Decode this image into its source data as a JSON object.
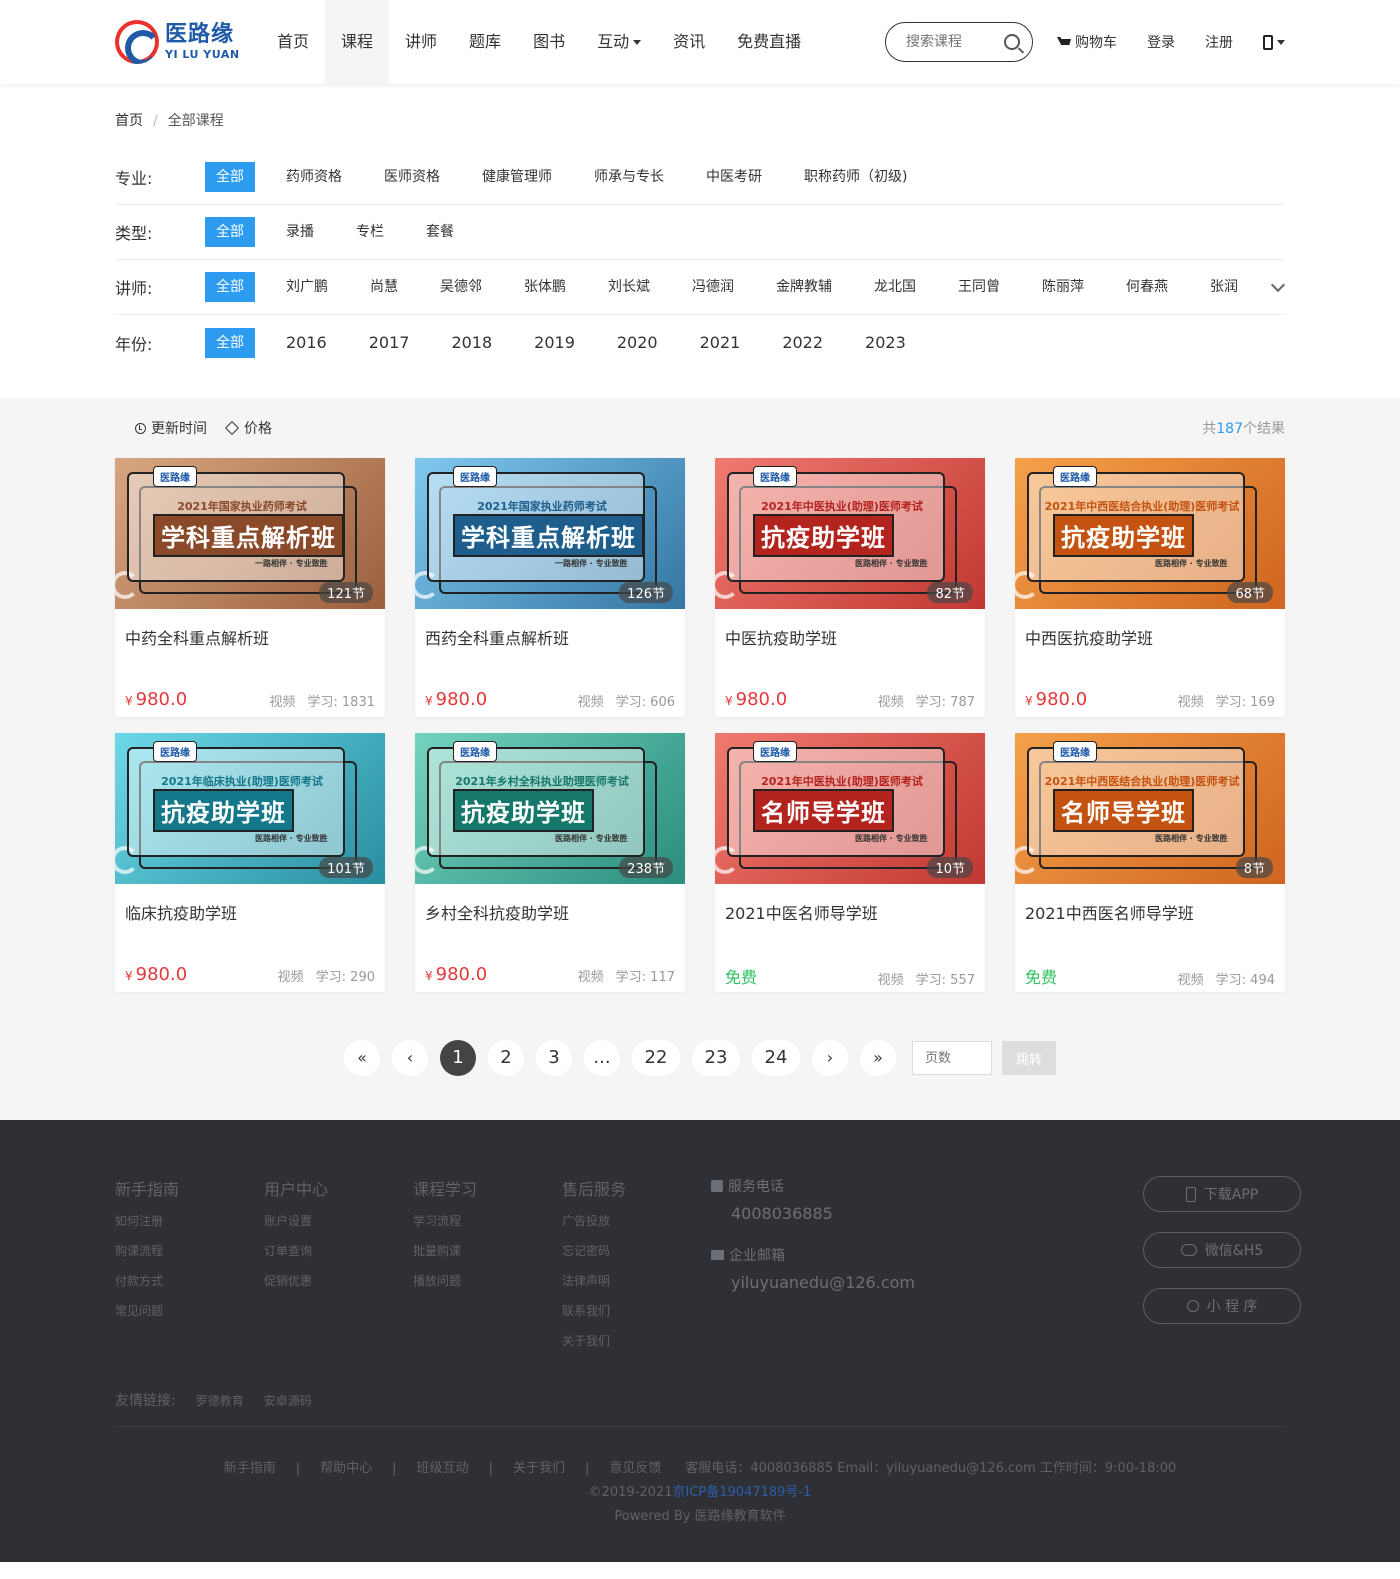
{
  "logo": {
    "cn": "医路缘",
    "en": "YI LU YUAN"
  },
  "nav": [
    {
      "label": "首页"
    },
    {
      "label": "课程",
      "active": true
    },
    {
      "label": "讲师"
    },
    {
      "label": "题库"
    },
    {
      "label": "图书"
    },
    {
      "label": "互动",
      "dropdown": true
    },
    {
      "label": "资讯"
    },
    {
      "label": "免费直播"
    }
  ],
  "search": {
    "placeholder": "搜索课程"
  },
  "header_links": {
    "cart": "购物车",
    "login": "登录",
    "register": "注册"
  },
  "breadcrumb": {
    "home": "首页",
    "current": "全部课程"
  },
  "filters": {
    "specialty": {
      "label": "专业:",
      "options": [
        "全部",
        "药师资格",
        "医师资格",
        "健康管理师",
        "师承与专长",
        "中医考研",
        "职称药师（初级)"
      ]
    },
    "type": {
      "label": "类型:",
      "options": [
        "全部",
        "录播",
        "专栏",
        "套餐"
      ]
    },
    "teacher": {
      "label": "讲师:",
      "options": [
        "全部",
        "刘广鹏",
        "尚慧",
        "吴德邻",
        "张体鹏",
        "刘长斌",
        "冯德润",
        "金牌教辅",
        "龙北国",
        "王同曾",
        "陈丽萍",
        "何春燕",
        "张润"
      ]
    },
    "year": {
      "label": "年份:",
      "options": [
        "全部",
        "2016",
        "2017",
        "2018",
        "2019",
        "2020",
        "2021",
        "2022",
        "2023"
      ]
    }
  },
  "sort": {
    "update_time": "更新时间",
    "price": "价格",
    "total_prefix": "共",
    "total": "187",
    "total_suffix": "个结果"
  },
  "courses": [
    {
      "title": "中药全科重点解析班",
      "price": "980.0",
      "currency": "¥",
      "type": "视频",
      "study": "学习: 1831",
      "lessons": "121节",
      "thumb_exam": "2021年国家执业药师考试",
      "thumb_title": "学科重点解析班",
      "thumb_sub": "一路相伴 · 专业致胜",
      "theme": "#d7a680",
      "accent": "#8a4a2a"
    },
    {
      "title": "西药全科重点解析班",
      "price": "980.0",
      "currency": "¥",
      "type": "视频",
      "study": "学习: 606",
      "lessons": "126节",
      "thumb_exam": "2021年国家执业药师考试",
      "thumb_title": "学科重点解析班",
      "thumb_sub": "一路相伴 · 专业致胜",
      "theme": "#7fc8ee",
      "accent": "#1d5e8c"
    },
    {
      "title": "中医抗疫助学班",
      "price": "980.0",
      "currency": "¥",
      "type": "视频",
      "study": "学习: 787",
      "lessons": "82节",
      "thumb_exam": "2021年中医执业(助理)医师考试",
      "thumb_title": "抗疫助学班",
      "thumb_sub": "医路相伴 · 专业致胜",
      "theme": "#f07a70",
      "accent": "#b3241f"
    },
    {
      "title": "中西医抗疫助学班",
      "price": "980.0",
      "currency": "¥",
      "type": "视频",
      "study": "学习: 169",
      "lessons": "68节",
      "thumb_exam": "2021年中西医结合执业(助理)医师考试",
      "thumb_title": "抗疫助学班",
      "thumb_sub": "医路相伴 · 专业致胜",
      "theme": "#f5a04a",
      "accent": "#c45312"
    },
    {
      "title": "临床抗疫助学班",
      "price": "980.0",
      "currency": "¥",
      "type": "视频",
      "study": "学习: 290",
      "lessons": "101节",
      "thumb_exam": "2021年临床执业(助理)医师考试",
      "thumb_title": "抗疫助学班",
      "thumb_sub": "医路相伴 · 专业致胜",
      "theme": "#6dd8e8",
      "accent": "#14778a"
    },
    {
      "title": "乡村全科抗疫助学班",
      "price": "980.0",
      "currency": "¥",
      "type": "视频",
      "study": "学习: 117",
      "lessons": "238节",
      "thumb_exam": "2021年乡村全科执业助理医师考试",
      "thumb_title": "抗疫助学班",
      "thumb_sub": "医路相伴 · 专业致胜",
      "theme": "#72d3be",
      "accent": "#16786a"
    },
    {
      "title": "2021中医名师导学班",
      "price": "免费",
      "currency": "",
      "free": true,
      "type": "视频",
      "study": "学习: 557",
      "lessons": "10节",
      "thumb_exam": "2021年中医执业(助理)医师考试",
      "thumb_title": "名师导学班",
      "thumb_sub": "医路相伴 · 专业致胜",
      "theme": "#f07a70",
      "accent": "#b3241f"
    },
    {
      "title": "2021中西医名师导学班",
      "price": "免费",
      "currency": "",
      "free": true,
      "type": "视频",
      "study": "学习: 494",
      "lessons": "8节",
      "thumb_exam": "2021年中西医结合执业(助理)医师考试",
      "thumb_title": "名师导学班",
      "thumb_sub": "医路相伴 · 专业致胜",
      "theme": "#f5a04a",
      "accent": "#c45312"
    }
  ],
  "pagination": {
    "first": "«",
    "prev": "‹",
    "pages": [
      "1",
      "2",
      "3",
      "...",
      "22",
      "23",
      "24"
    ],
    "current": "1",
    "next": "›",
    "last": "»",
    "input_placeholder": "页数",
    "go": "跳转"
  },
  "footer": {
    "columns": [
      {
        "title": "新手指南",
        "links": [
          "如何注册",
          "购课流程",
          "付款方式",
          "常见问题"
        ]
      },
      {
        "title": "用户中心",
        "links": [
          "账户设置",
          "订单查询",
          "促销优惠"
        ]
      },
      {
        "title": "课程学习",
        "links": [
          "学习流程",
          "批量购课",
          "播放问题"
        ]
      },
      {
        "title": "售后服务",
        "links": [
          "广告投放",
          "忘记密码",
          "法律声明",
          "联系我们",
          "关于我们"
        ]
      }
    ],
    "contact": {
      "phone_label": "服务电话",
      "phone": "4008036885",
      "email_label": "企业邮箱",
      "email": "yiluyuanedu@126.com"
    },
    "buttons": {
      "app": "下载APP",
      "wechat": "微信&H5",
      "mini": "小 程 序"
    },
    "friend_label": "友情链接:",
    "friends": [
      "罗德教育",
      "安卓源码"
    ],
    "bottom_links": [
      "新手指南",
      "帮助中心",
      "班级互动",
      "关于我们",
      "意见反馈"
    ],
    "service": "客服电话：4008036885 Email：yiluyuanedu@126.com 工作时间：9:00-18:00",
    "copyright": "©2019-2021",
    "icp": "京ICP备19047189号-1",
    "powered": "Powered By 医路缘教育软件"
  }
}
